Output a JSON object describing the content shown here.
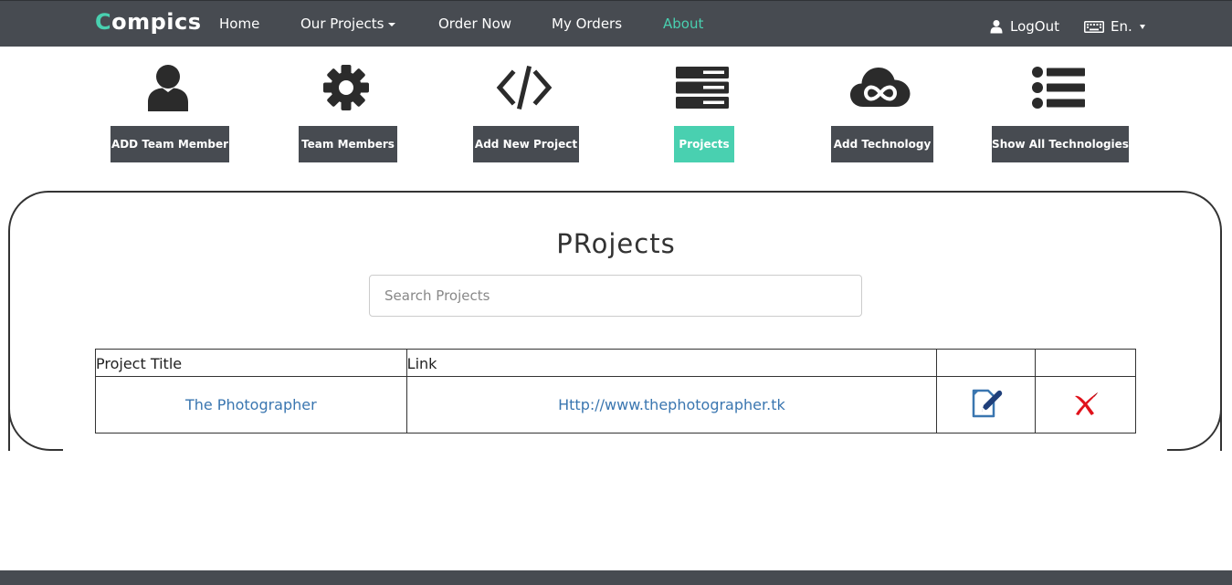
{
  "nav": {
    "brand_first": "C",
    "brand_rest": "ompics",
    "home": "Home",
    "our_projects": "Our Projects",
    "order_now": "Order Now",
    "my_orders": "My Orders",
    "about": "About",
    "logout": "LogOut",
    "language": "En.",
    "accent_color": "#49d0b0"
  },
  "tools": [
    {
      "icon": "user-icon",
      "label": "ADD Team Member"
    },
    {
      "icon": "gear-icon",
      "label": "Team Members"
    },
    {
      "icon": "code-icon",
      "label": "Add New Project"
    },
    {
      "icon": "server-icon",
      "label": "Projects",
      "active": true
    },
    {
      "icon": "cloud-infinity-icon",
      "label": "Add Technology"
    },
    {
      "icon": "list-icon",
      "label": "Show All Technologies"
    }
  ],
  "main": {
    "title": "PRojects",
    "search_placeholder": "Search Projects"
  },
  "table": {
    "headers": [
      "Project Title",
      "Link",
      "",
      ""
    ],
    "rows": [
      {
        "title": "The Photographer",
        "link": "Http://www.thephotographer.tk",
        "edit_icon": "edit-icon",
        "delete_icon": "delete-icon"
      }
    ]
  }
}
